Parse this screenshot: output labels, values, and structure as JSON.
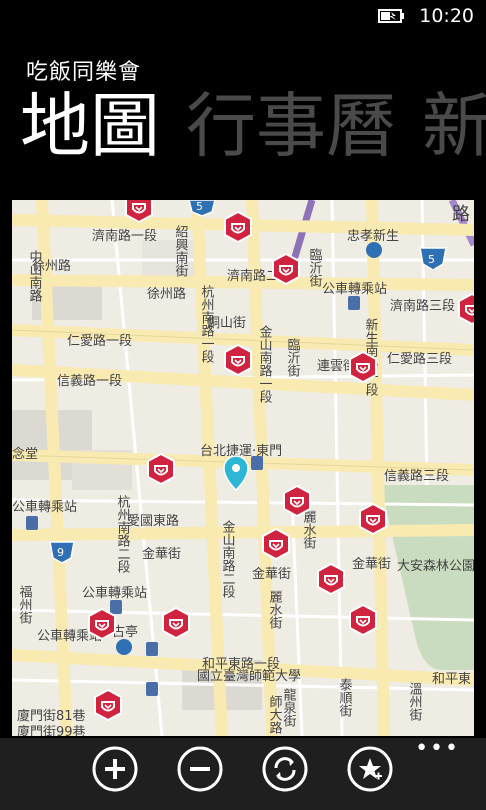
{
  "status": {
    "time": "10:20",
    "battery_icon": "battery-charging-icon"
  },
  "app": {
    "title": "吃飯同樂會"
  },
  "pivot": {
    "active": "地圖",
    "next": "行事曆",
    "partial": "新"
  },
  "map": {
    "labels": {
      "jinan_1": "濟南路一段",
      "jinan_2": "濟南路二段",
      "jinan_3": "濟南路三段",
      "xuzhou": "徐州路",
      "renai_1": "仁愛路一段",
      "renai_3": "仁愛路三段",
      "xinyi_1": "信義路一段",
      "xinyi_3": "信義路三段",
      "zhongshan_s": "中山南路",
      "shaoxing_s": "紹興南街",
      "hangzhou_n": "杭州南路一段",
      "hangzhou_s": "杭州南路二段",
      "jinshan_1": "金山南路一段",
      "jinshan_2": "金山南路二段",
      "tongshan": "銅山街",
      "linyi": "臨沂街",
      "linyi2": "臨沂街",
      "xinsheng": "新生南路一段",
      "lianyun": "連雲街",
      "aiguo": "愛國東路",
      "jinhua1": "金華街",
      "jinhua2": "金華街",
      "jinhua3": "金華街",
      "lishui": "麗水街",
      "lishui2": "麗水街",
      "heping": "和平東路一段",
      "heping_r": "和平東",
      "mrt_station": "台北捷運‧東門",
      "ntnu": "國立臺灣師範大學",
      "park": "大安森林公園",
      "zhongxiao_station": "忠孝新生",
      "bus1": "公車轉乘站",
      "bus2": "公車轉乘站",
      "bus3": "公車轉乘站",
      "bus4": "公車轉乘站",
      "xiamen81": "廈門街81巷",
      "xiamen99": "廈門街99巷",
      "fuzhou": "福州街",
      "guling": "古亭",
      "taishun": "泰順街",
      "wenzhou": "溫州街",
      "longquan": "龍泉街",
      "shida": "師大路",
      "nian": "念堂",
      "route_5a": "5",
      "route_5b": "5",
      "route_9": "9",
      "lu": "路"
    }
  },
  "appbar": {
    "buttons": [
      "zoom-in-icon",
      "zoom-out-icon",
      "refresh-icon",
      "favorites-icon"
    ],
    "more": "•••"
  }
}
